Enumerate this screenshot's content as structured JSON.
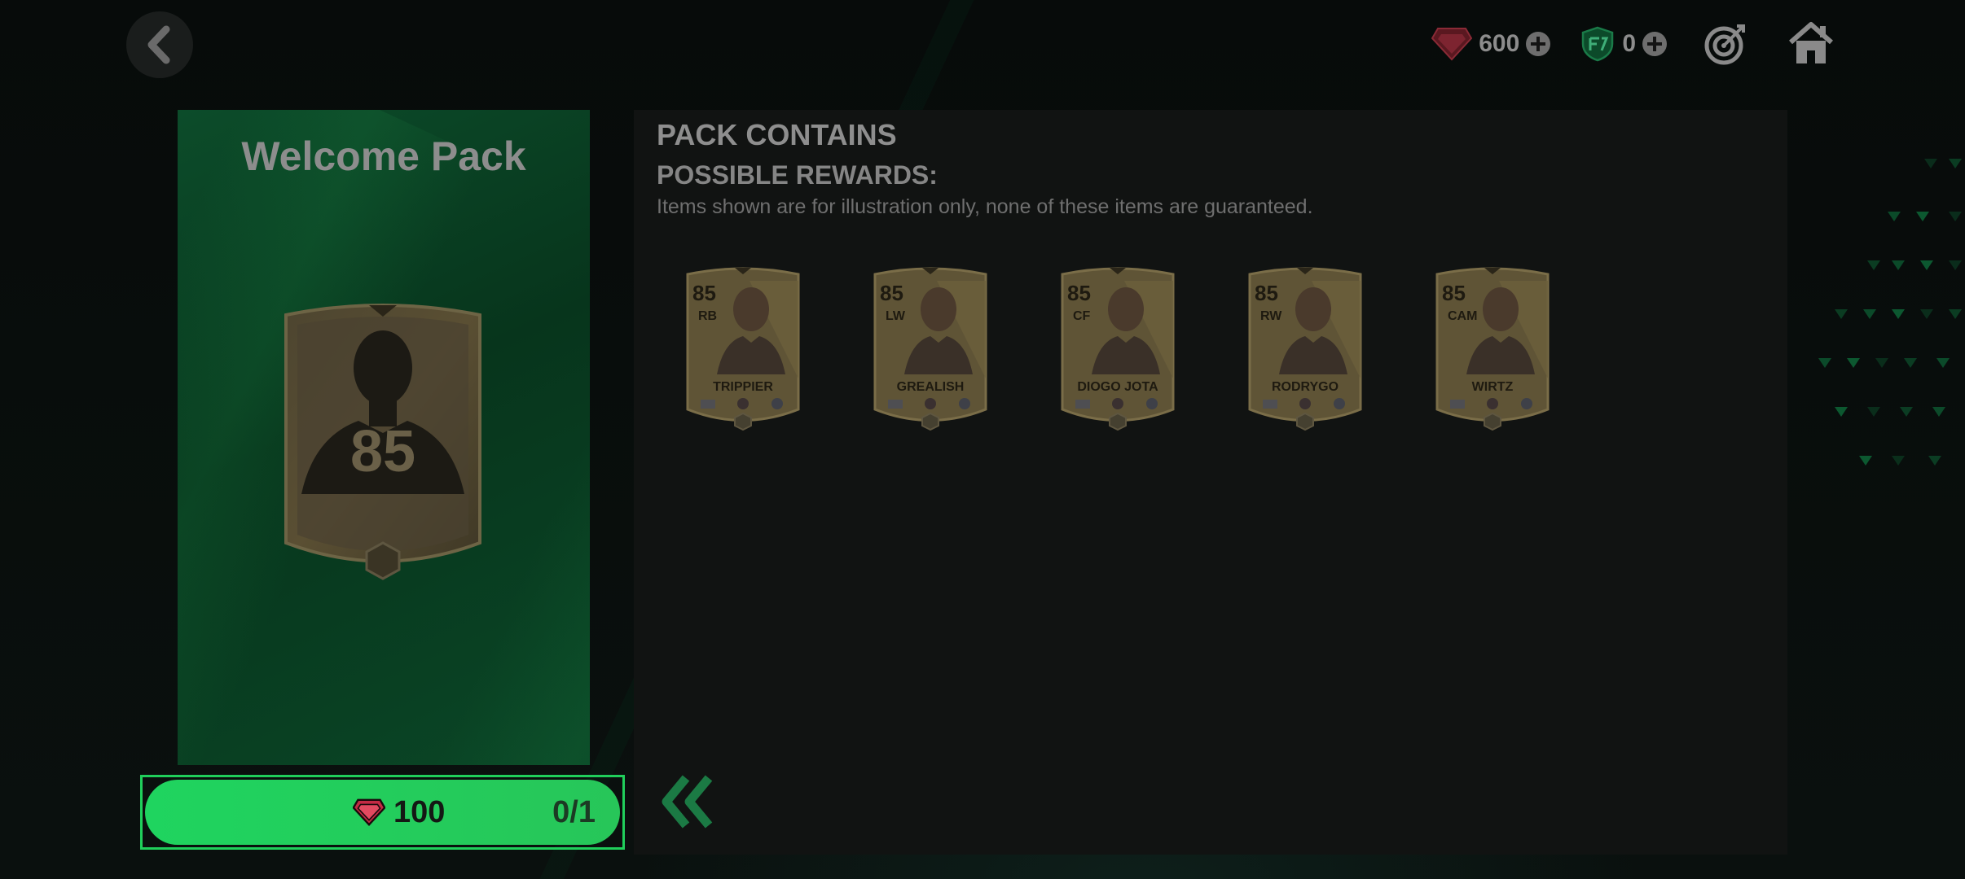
{
  "topbar": {
    "gems": {
      "icon": "red-gem-icon",
      "value": "600"
    },
    "coins": {
      "icon": "fc-shield-coin-icon",
      "value": "0"
    },
    "objectives_icon": "target-icon",
    "home_icon": "home-icon"
  },
  "pack": {
    "title": "Welcome Pack",
    "card_rating": "85",
    "price": "100",
    "purchase_count": "0/1"
  },
  "contents": {
    "heading": "PACK CONTAINS",
    "subheading": "POSSIBLE REWARDS:",
    "disclaimer": "Items shown are for illustration only, none of these items are guaranteed.",
    "cards": [
      {
        "rating": "85",
        "position": "RB",
        "name": "TRIPPIER"
      },
      {
        "rating": "85",
        "position": "LW",
        "name": "GREALISH"
      },
      {
        "rating": "85",
        "position": "CF",
        "name": "DIOGO JOTA"
      },
      {
        "rating": "85",
        "position": "RW",
        "name": "RODRYGO"
      },
      {
        "rating": "85",
        "position": "CAM",
        "name": "WIRTZ"
      }
    ]
  },
  "colors": {
    "accent_green": "#22d05d",
    "gem_red": "#d8344c",
    "card_gold": "#b59a52"
  }
}
